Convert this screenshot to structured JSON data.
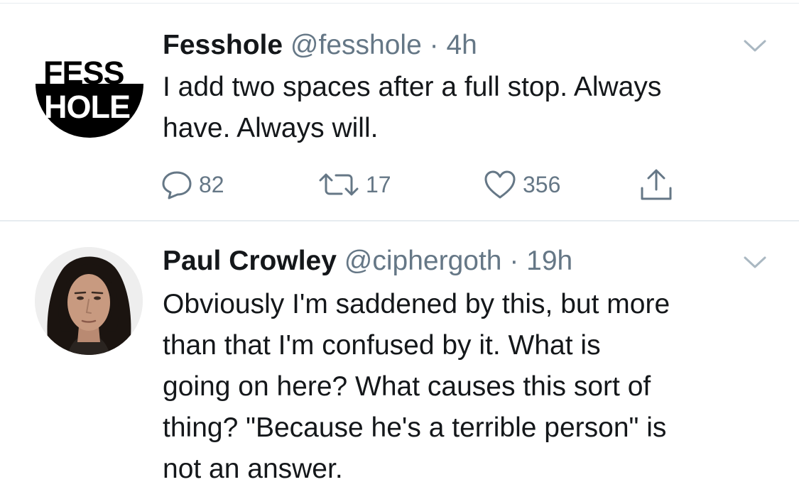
{
  "tweets": [
    {
      "author": {
        "name": "Fesshole",
        "handle": "@fesshole",
        "avatar_logo": [
          "FESS",
          "HOLE"
        ]
      },
      "separator": "·",
      "time": "4h",
      "text_lines": [
        "I add two spaces after a full stop. Always",
        "have. Always will."
      ],
      "stats": {
        "replies": "82",
        "retweets": "17",
        "likes": "356"
      },
      "icons": {
        "menu": "chevron-down-icon",
        "reply": "reply-icon",
        "retweet": "retweet-icon",
        "like": "heart-icon",
        "share": "share-icon"
      }
    },
    {
      "author": {
        "name": "Paul Crowley",
        "handle": "@ciphergoth"
      },
      "separator": "·",
      "time": "19h",
      "text_lines": [
        "Obviously I'm saddened by this, but more",
        "than that I'm confused by it. What is",
        "going on here? What causes this sort of",
        "thing? \"Because he's a terrible person\" is",
        "not an answer."
      ],
      "icons": {
        "menu": "chevron-down-icon"
      }
    }
  ],
  "colors": {
    "text": "#14171a",
    "secondary": "#657786",
    "divider": "#e6ecf0"
  }
}
